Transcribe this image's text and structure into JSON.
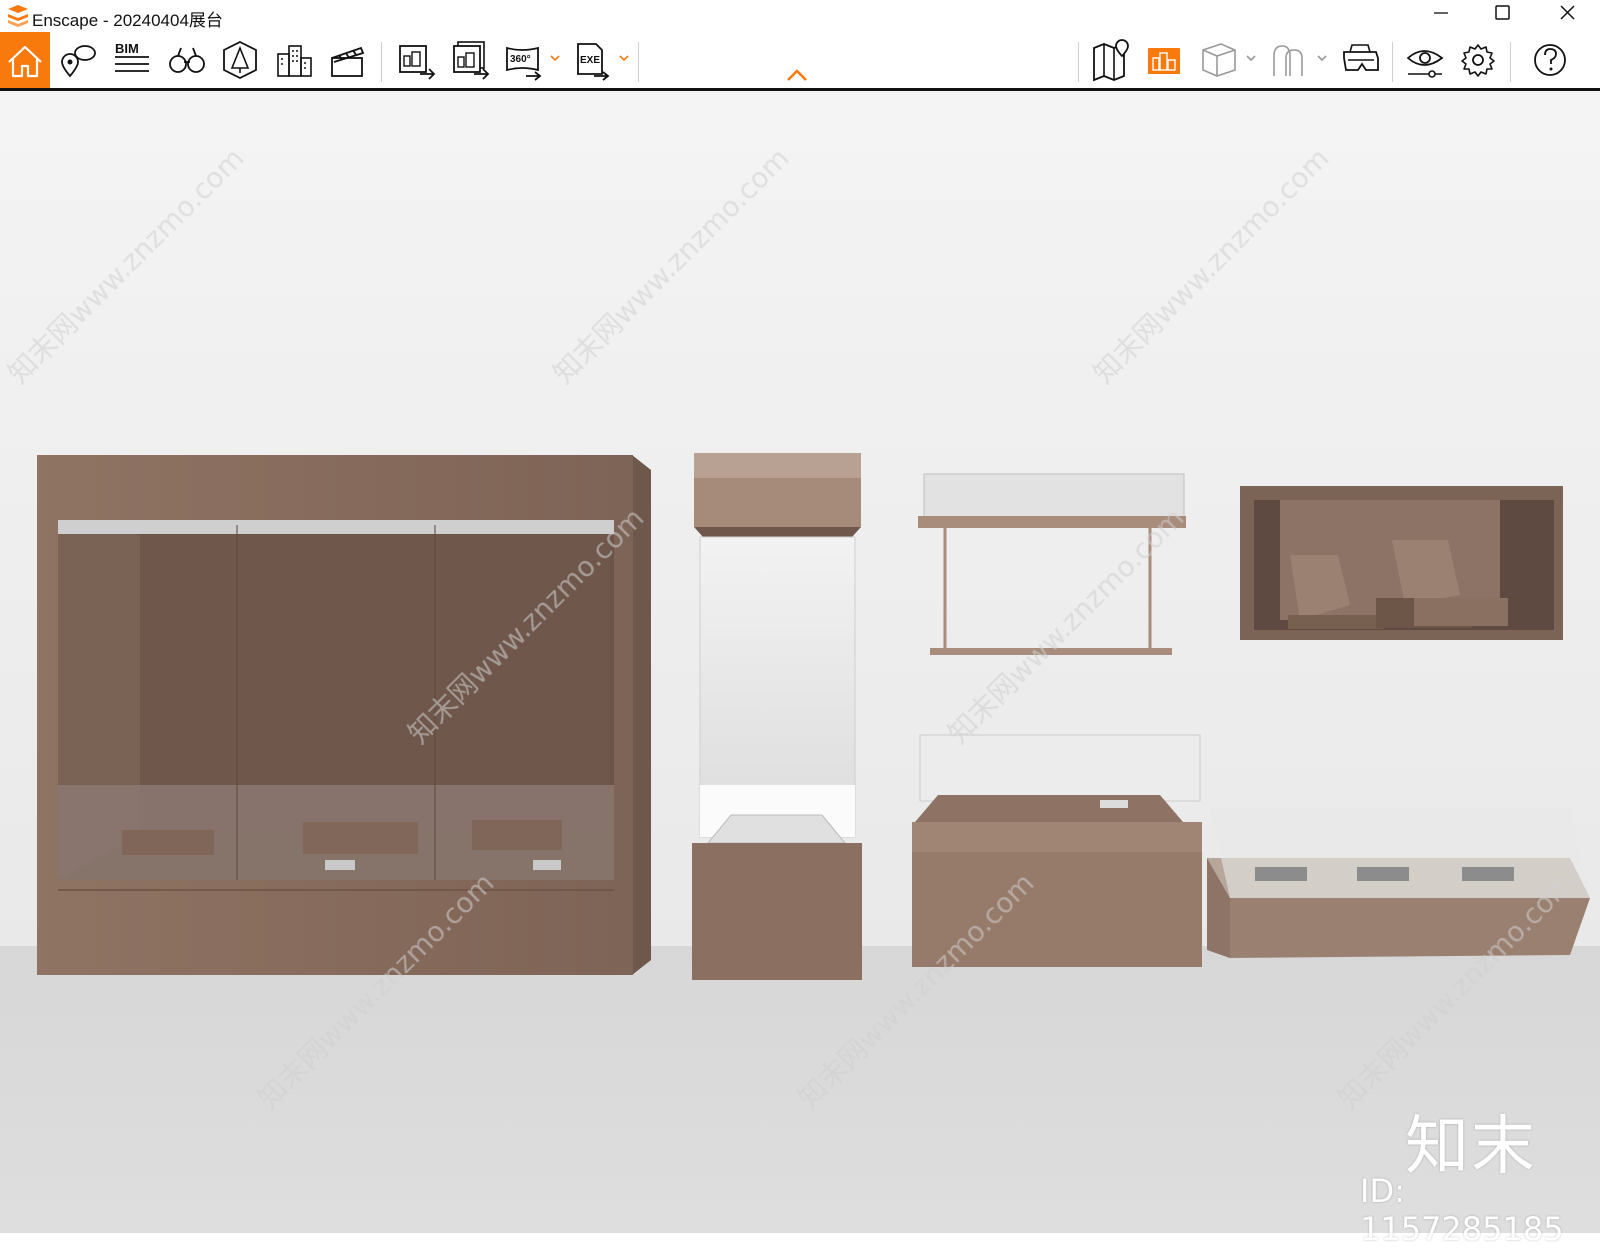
{
  "window": {
    "title": "Enscape - 20240404展台",
    "minimize_icon": "minimize-icon",
    "maximize_icon": "maximize-icon",
    "close_icon": "close-icon"
  },
  "toolbar": {
    "left_tools": [
      "home-icon",
      "location-pins-icon",
      "bim-icon",
      "binoculars-icon",
      "asset-library-icon",
      "buildings-icon",
      "clapperboard-icon"
    ],
    "bim_label": "BIM",
    "export_tools": [
      "render-image-icon",
      "batch-render-icon",
      "panorama-360-icon",
      "export-exe-icon"
    ],
    "panorama_label": "360°",
    "exe_label": "EXE",
    "right_tools": [
      "map-icon",
      "site-context-icon",
      "cube-view-icon",
      "people-icon",
      "vr-headset-icon",
      "visual-settings-icon",
      "gear-icon",
      "help-icon"
    ],
    "accent_color": "#f97a0c"
  },
  "watermark": {
    "logo": "知末",
    "id_text": "ID: 1157285185",
    "diagonal": "知末网www.znzmo.com"
  }
}
